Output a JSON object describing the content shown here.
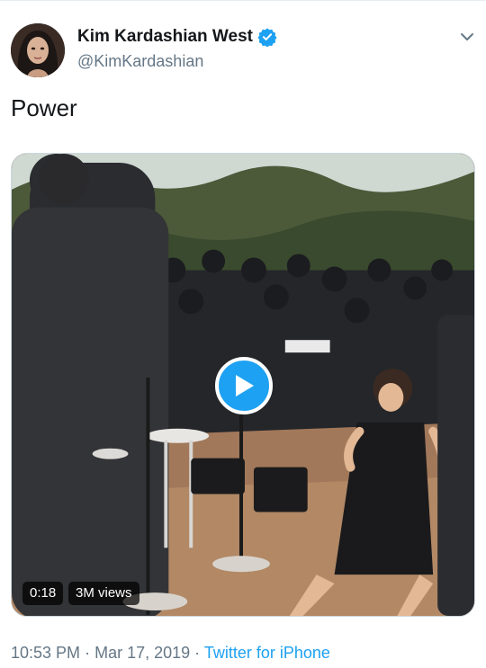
{
  "tweet": {
    "author": {
      "display_name": "Kim Kardashian West",
      "handle": "@KimKardashian",
      "verified": true,
      "avatar_icon": "profile-photo"
    },
    "menu_icon": "chevron-down-icon",
    "text": "Power",
    "media": {
      "type": "video",
      "play_icon": "play-icon",
      "duration": "0:18",
      "views": "3M views"
    },
    "meta": {
      "time": "10:53 PM",
      "separator": "·",
      "date": "Mar 17, 2019",
      "source": "Twitter for iPhone"
    }
  },
  "colors": {
    "accent": "#1da1f2",
    "secondary_text": "#657786",
    "primary_text": "#14171a"
  }
}
